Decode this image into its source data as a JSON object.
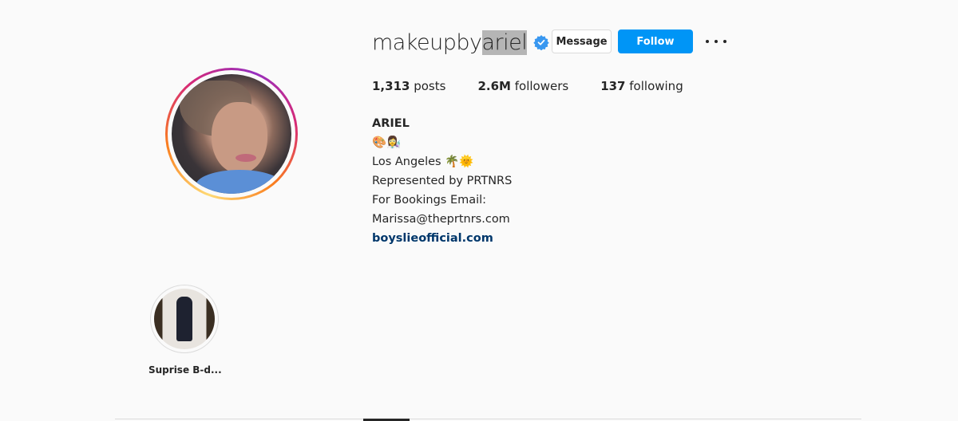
{
  "profile": {
    "username_prefix": "makeupby",
    "username_selected": "ariel",
    "verified": true,
    "avatar_alt": "profile picture"
  },
  "actions": {
    "message_label": "Message",
    "follow_label": "Follow",
    "more_icon": "more-options-icon"
  },
  "stats": [
    {
      "value": "1,313",
      "label": "posts"
    },
    {
      "value": "2.6M",
      "label": "followers"
    },
    {
      "value": "137",
      "label": "following"
    }
  ],
  "bio": {
    "name": "ARIEL",
    "emoji_line": "🎨👩‍🔬",
    "location": "Los Angeles 🌴🌞",
    "line1": "Represented by PRTNRS",
    "line2": "For Bookings Email:",
    "line3": "Marissa@theprtnrs.com",
    "link": "boyslieofficial.com"
  },
  "highlights": [
    {
      "label": "Suprise B-d..."
    }
  ],
  "colors": {
    "follow_button": "#0095f6",
    "verified_badge": "#3897f0",
    "link": "#00376b"
  }
}
